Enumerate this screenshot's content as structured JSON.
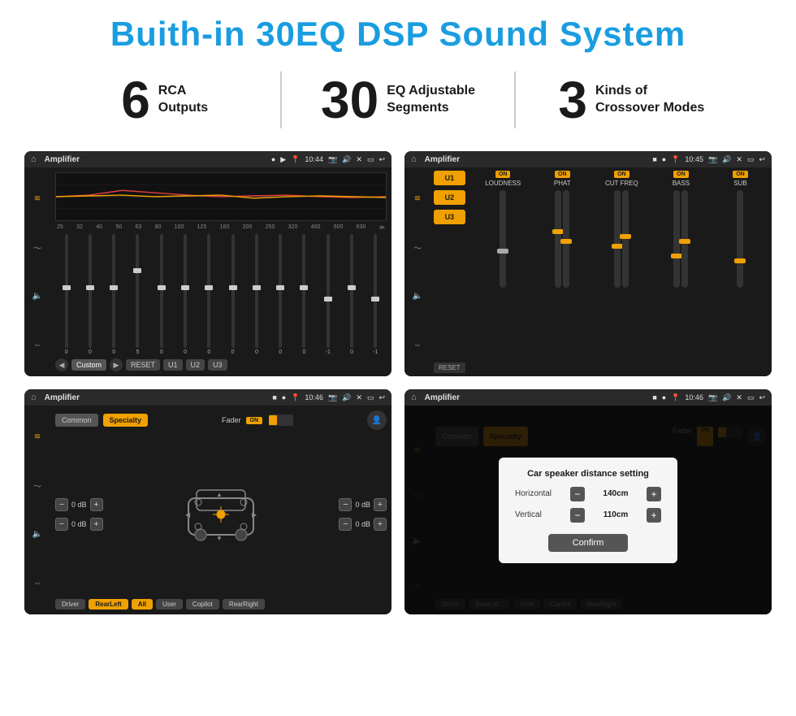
{
  "header": {
    "title": "Buith-in 30EQ DSP Sound System"
  },
  "stats": [
    {
      "number": "6",
      "line1": "RCA",
      "line2": "Outputs"
    },
    {
      "number": "30",
      "line1": "EQ Adjustable",
      "line2": "Segments"
    },
    {
      "number": "3",
      "line1": "Kinds of",
      "line2": "Crossover Modes"
    }
  ],
  "screens": {
    "eq": {
      "app_name": "Amplifier",
      "time": "10:44",
      "freq_labels": [
        "25",
        "32",
        "40",
        "50",
        "63",
        "80",
        "100",
        "125",
        "160",
        "200",
        "250",
        "320",
        "400",
        "500",
        "630"
      ],
      "slider_values": [
        "0",
        "0",
        "0",
        "5",
        "0",
        "0",
        "0",
        "0",
        "0",
        "0",
        "0",
        "-1",
        "0",
        "-1"
      ],
      "buttons": [
        "Custom",
        "RESET",
        "U1",
        "U2",
        "U3"
      ]
    },
    "amp": {
      "app_name": "Amplifier",
      "time": "10:45",
      "u_buttons": [
        "U1",
        "U2",
        "U3"
      ],
      "channels": [
        {
          "label": "LOUDNESS",
          "on": true
        },
        {
          "label": "PHAT",
          "on": true
        },
        {
          "label": "CUT FREQ",
          "on": true
        },
        {
          "label": "BASS",
          "on": true
        },
        {
          "label": "SUB",
          "on": true
        }
      ],
      "reset_label": "RESET"
    },
    "fader": {
      "app_name": "Amplifier",
      "time": "10:46",
      "common_label": "Common",
      "specialty_label": "Specialty",
      "fader_label": "Fader",
      "on_label": "ON",
      "db_values": [
        "0 dB",
        "0 dB",
        "0 dB",
        "0 dB"
      ],
      "buttons": [
        "Driver",
        "RearLeft",
        "All",
        "User",
        "Copilot",
        "RearRight"
      ]
    },
    "dialog": {
      "app_name": "Amplifier",
      "time": "10:46",
      "common_label": "Common",
      "specialty_label": "Specialty",
      "on_label": "ON",
      "dialog_title": "Car speaker distance setting",
      "horizontal_label": "Horizontal",
      "horizontal_value": "140cm",
      "vertical_label": "Vertical",
      "vertical_value": "110cm",
      "db_right_top": "0 dB",
      "db_right_bottom": "0 dB",
      "confirm_label": "Confirm",
      "driver_label": "Driver",
      "copilot_label": "Copilot",
      "rearleft_label": "RearLef...",
      "rearright_label": "RearRight"
    }
  }
}
